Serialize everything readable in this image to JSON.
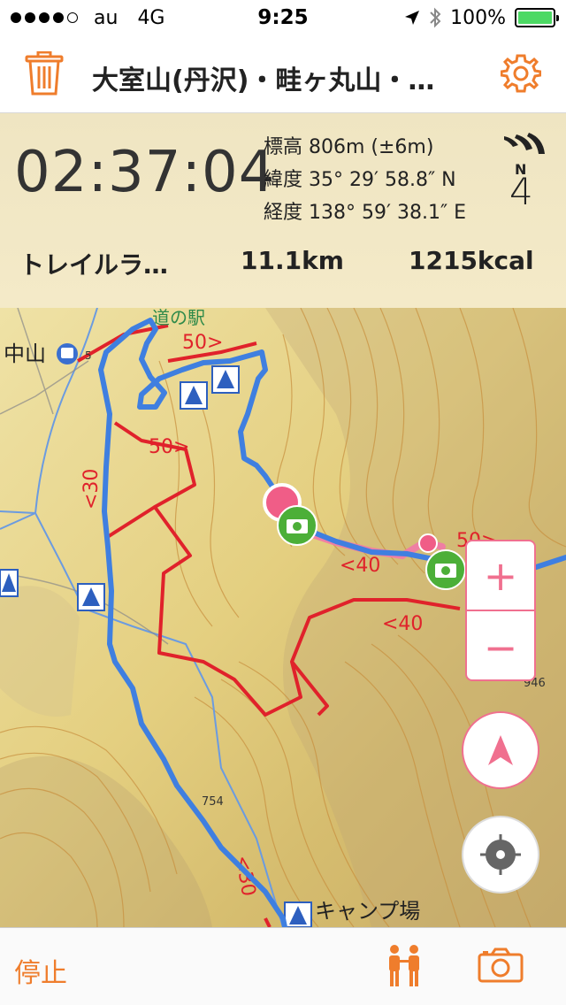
{
  "status_bar": {
    "carrier": "au",
    "network": "4G",
    "time": "9:25",
    "battery": "100%",
    "signal_bars": 4
  },
  "nav": {
    "title": "大室山(丹沢)・畦ヶ丸山・…"
  },
  "info": {
    "elapsed": "02:37:04",
    "altitude": "標高 806m (±6m)",
    "latitude": "緯度 35° 29′ 58.8″ N",
    "longitude": "経度 138° 59′ 38.1″ E",
    "compass_letter": "N",
    "compass_value": "4",
    "activity": "トレイルラ…",
    "distance": "11.1km",
    "calories": "1215kcal"
  },
  "map": {
    "labels": {
      "station": "中山",
      "road_station": "道の駅",
      "speed_50_top": "50>",
      "speed_50_mid": "50>",
      "speed_30_left": "<30",
      "speed_40_mid": "<40",
      "speed_40_low": "<40",
      "speed_50_right": "50>",
      "speed_30_bottom": "<30",
      "elev_754": "754",
      "elev_946": "946",
      "campsite": "キャンプ場",
      "bus_stop": "5"
    },
    "zoom_in": "+",
    "zoom_out": "−"
  },
  "bottom": {
    "stop_label": "停止"
  },
  "colors": {
    "accent": "#ef7d2c",
    "pink": "#f0708f",
    "route_blue": "#3f7fe0",
    "boundary_red": "#e0222b",
    "camera_green": "#4caf38"
  }
}
